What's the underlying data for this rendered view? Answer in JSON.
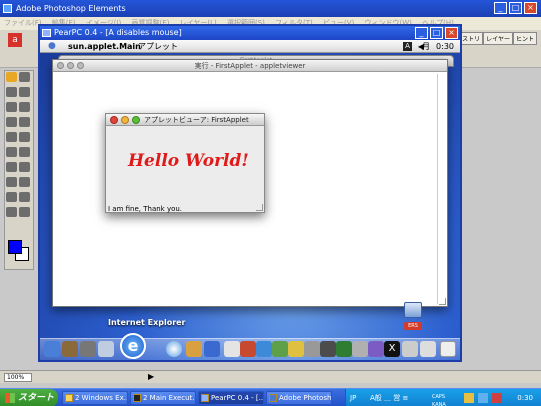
{
  "photoshop": {
    "title": "Adobe Photoshop Elements",
    "menu": [
      "ファイル(F)",
      "編集(E)",
      "イメージ(I)",
      "画質調整(E)",
      "レイヤー(L)",
      "選択範囲(S)",
      "フィルタ(T)",
      "ビュー(V)",
      "ウィンドウ(W)",
      "ヘルプ(H)"
    ],
    "right_tabs": [
      "ヒストリ",
      "レイヤー",
      "ヒント"
    ],
    "zoom": "100%"
  },
  "pearpc": {
    "title": "PearPC 0.4 - [A disables mouse]"
  },
  "mac": {
    "app_name": "sun.applet.Main",
    "menu_item": "アプレット",
    "ime": "A",
    "tsuki": "月",
    "clock": "0:30",
    "bg_window_title": "FirstApplet",
    "viewer_title": "実行 - FirstApplet - appletviewer",
    "applet_title": "アプレットビューア: FirstApplet",
    "hello_text": "Hello World!",
    "status_text": "I am fine, Thank you.",
    "dock_label": "Internet Explorer",
    "ers_label": "ERS"
  },
  "taskbar": {
    "start": "スタート",
    "buttons": [
      "2 Windows Ex...",
      "2 Main Execut...",
      "PearPC 0.4 - [...",
      "Adobe Photosh..."
    ],
    "tray_lang": "JP",
    "tray_text": "A般 ＿ 営 ≡",
    "tray_caps": "CAPS KANA",
    "clock": "0:30"
  },
  "colors": {
    "hello": "#e01a1a",
    "fg_swatch": "#0000ff",
    "xp_blue": "#2456d9"
  }
}
